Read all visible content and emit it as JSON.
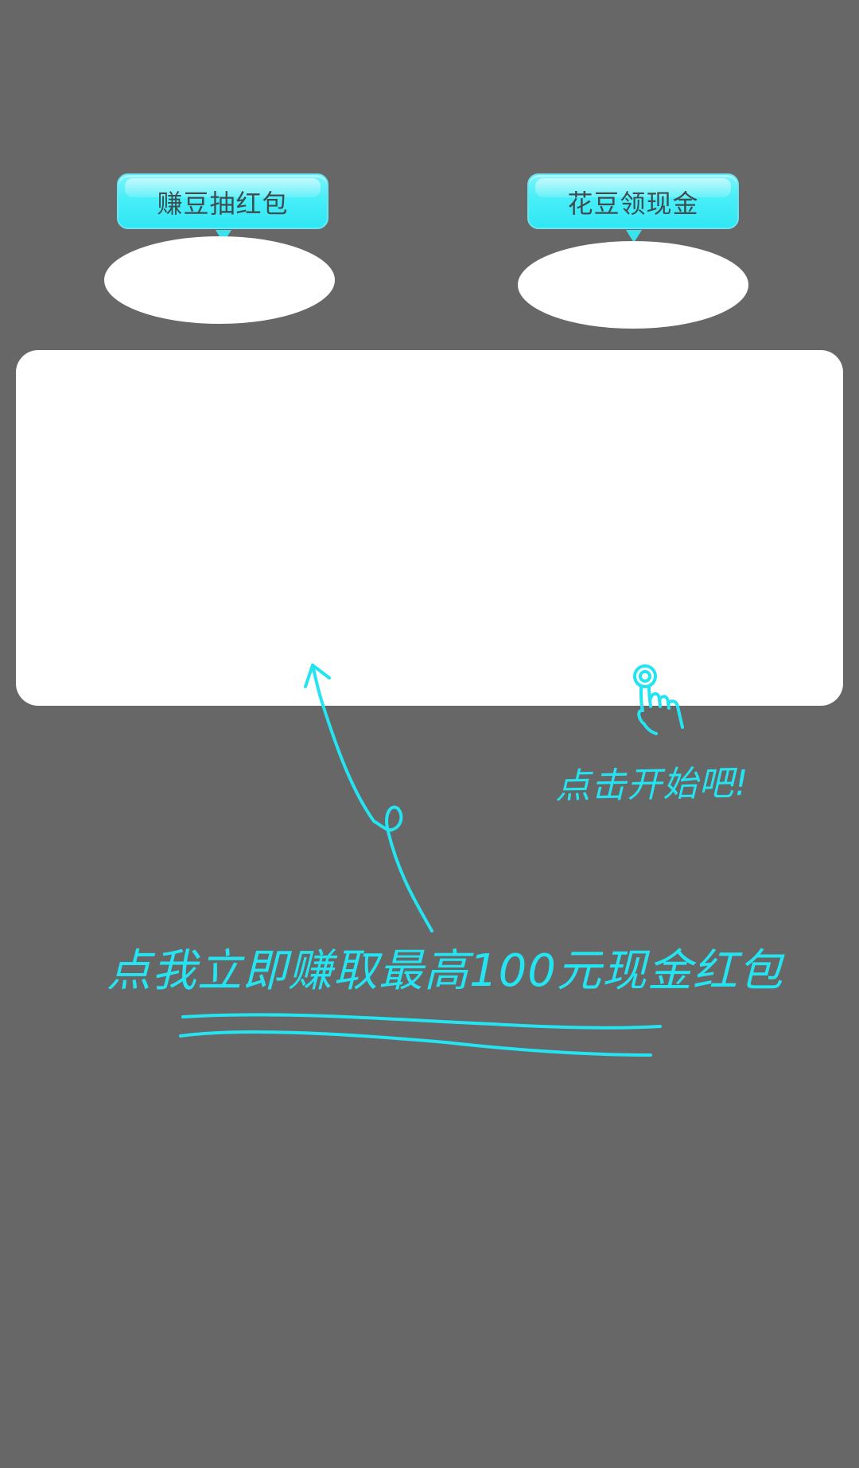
{
  "buttons": {
    "earn_beans_draw_red_packet": "赚豆抽红包",
    "spend_beans_get_cash": "花豆领现金"
  },
  "hints": {
    "tap_to_start": "点击开始吧!",
    "earn_red_packet_cta": "点我立即赚取最高100元现金红包"
  },
  "colors": {
    "background": "#676767",
    "accent": "#25e4f1",
    "card": "#ffffff"
  },
  "icons": {
    "tap_hand": "pointing-hand-icon",
    "arrow": "curved-up-arrow-icon"
  }
}
